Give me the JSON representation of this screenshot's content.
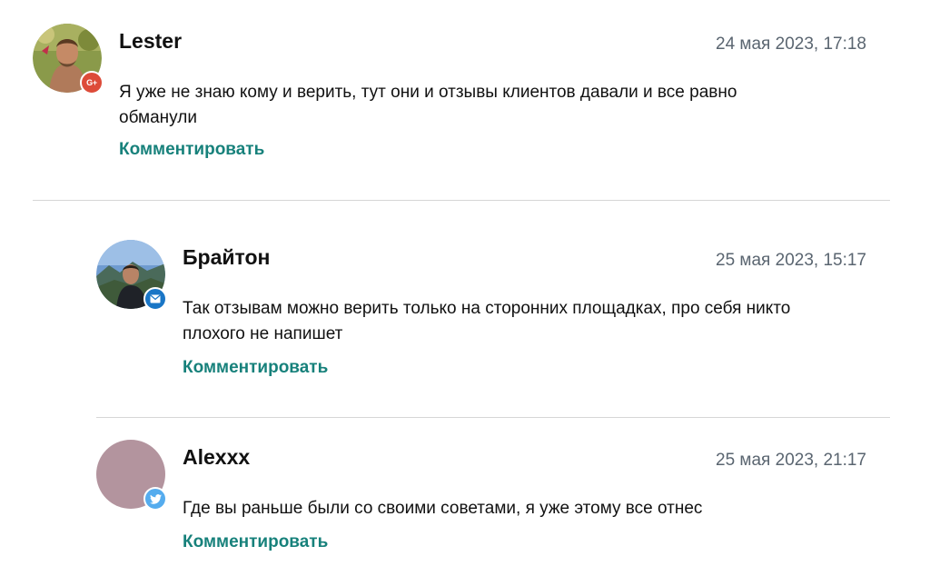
{
  "comments": [
    {
      "author": "Lester",
      "date": "24 мая 2023, 17:18",
      "text": "Я уже не знаю кому и верить, тут они и отзывы клиентов давали и все равно обманули",
      "reply_label": "Комментировать",
      "badge": {
        "icon": "google-plus-icon",
        "glyph": "G+",
        "color": "#dd4b39"
      }
    },
    {
      "author": "Брайтон",
      "date": "25 мая 2023, 15:17",
      "text": "Так отзывам можно верить только на сторонних площадках, про себя никто плохого не напишет",
      "reply_label": "Комментировать",
      "badge": {
        "icon": "mail-icon",
        "color": "#1a76c6"
      }
    },
    {
      "author": "Alexxx",
      "date": "25 мая 2023, 21:17",
      "text": "Где вы раньше были со своими советами, я уже этому все отнес",
      "reply_label": "Комментировать",
      "badge": {
        "icon": "twitter-icon",
        "color": "#55acee"
      }
    }
  ],
  "colors": {
    "accent": "#17817b",
    "date_text": "#5a6570",
    "divider": "#d6d6d6",
    "default_avatar": "#b3949e"
  }
}
